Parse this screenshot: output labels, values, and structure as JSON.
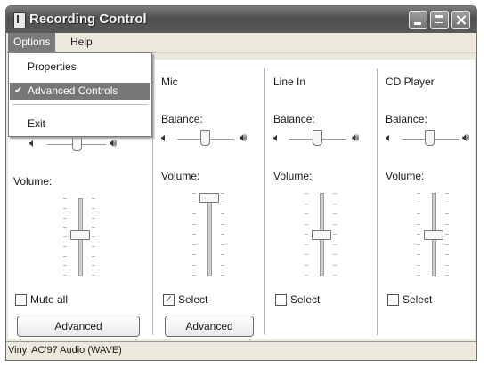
{
  "window": {
    "title": "Recording Control"
  },
  "menu": {
    "options": "Options",
    "help": "Help"
  },
  "dropdown": {
    "properties": "Properties",
    "advanced_controls": "Advanced Controls",
    "exit": "Exit",
    "checkmark": "✔"
  },
  "labels": {
    "balance": "Balance:",
    "volume": "Volume:"
  },
  "channels": [
    {
      "name": "",
      "checkbox_label": "Mute all",
      "checked": false,
      "balance": 0.5,
      "volume": 0.5,
      "advanced": "Advanced"
    },
    {
      "name": "Mic",
      "checkbox_label": "Select",
      "checked": true,
      "balance": 0.5,
      "volume": 0.9,
      "advanced": "Advanced"
    },
    {
      "name": "Line In",
      "checkbox_label": "Select",
      "checked": false,
      "balance": 0.5,
      "volume": 0.5
    },
    {
      "name": "CD Player",
      "checkbox_label": "Select",
      "checked": false,
      "balance": 0.5,
      "volume": 0.5
    }
  ],
  "status": {
    "text": "Vinyl AC'97 Audio (WAVE)"
  },
  "icons": {
    "speaker_left": "speaker-left-icon",
    "speaker_right": "speaker-right-icon",
    "check": "check-icon"
  }
}
